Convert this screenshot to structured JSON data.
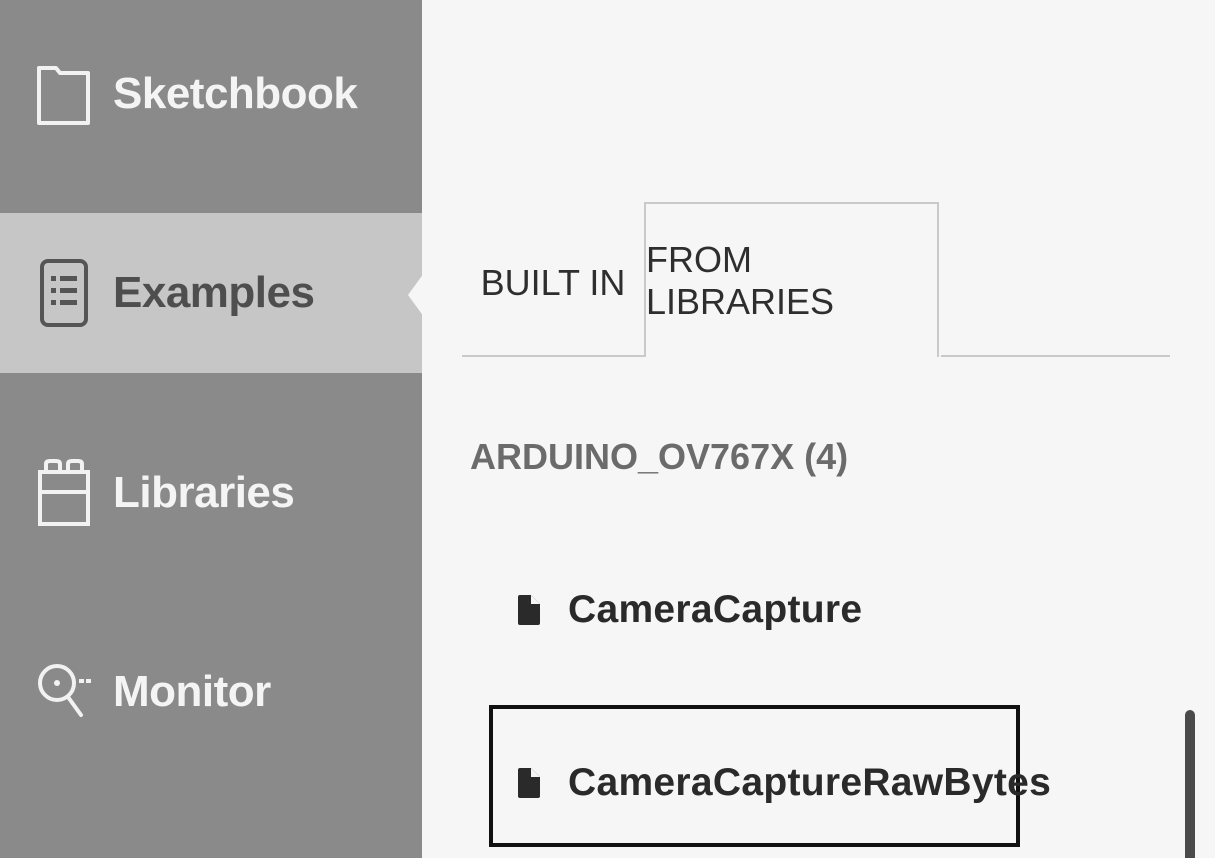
{
  "sidebar": {
    "items": [
      {
        "label": "Sketchbook",
        "icon": "folder-icon",
        "active": false
      },
      {
        "label": "Examples",
        "icon": "list-icon",
        "active": true
      },
      {
        "label": "Libraries",
        "icon": "library-icon",
        "active": false
      },
      {
        "label": "Monitor",
        "icon": "monitor-magnifier-icon",
        "active": false
      }
    ]
  },
  "tabs": [
    {
      "label": "BUILT IN",
      "active": false
    },
    {
      "label": "FROM LIBRARIES",
      "active": true
    }
  ],
  "section": {
    "heading": "ARDUINO_OV767X (4)"
  },
  "examples": [
    {
      "label": "CameraCapture",
      "icon": "file-icon",
      "highlighted": false
    },
    {
      "label": "CameraCaptureRawBytes",
      "icon": "file-icon",
      "highlighted": true
    }
  ],
  "colors": {
    "sidebar_bg": "#8a8a8a",
    "sidebar_active_bg": "#c6c6c6",
    "content_bg": "#f6f6f6",
    "highlight_border": "#111111"
  }
}
